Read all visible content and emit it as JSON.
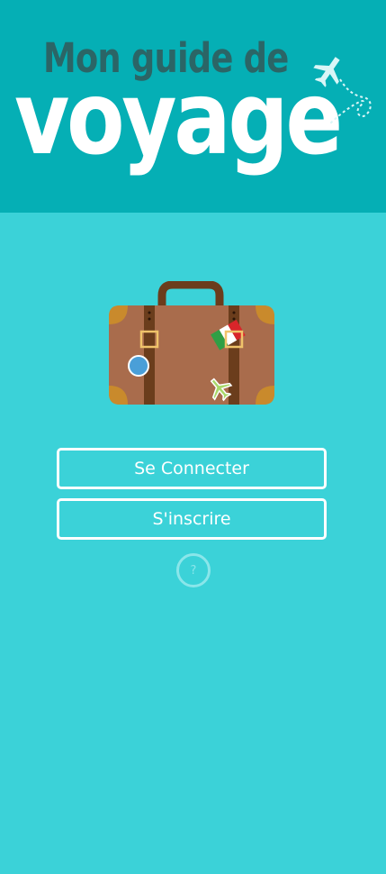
{
  "header": {
    "title_line1": "Mon guide de",
    "title_line2": "voyage",
    "decoration_icon": "airplane-dotted-trail-icon"
  },
  "illustration": {
    "icon": "suitcase-icon"
  },
  "actions": {
    "login_label": "Se Connecter",
    "signup_label": "S'inscrire",
    "help_label": "?"
  },
  "colors": {
    "background": "#3bd2d8",
    "header_background": "#05afb5",
    "title_dark": "#2b6566",
    "button_border": "#ffffff"
  }
}
